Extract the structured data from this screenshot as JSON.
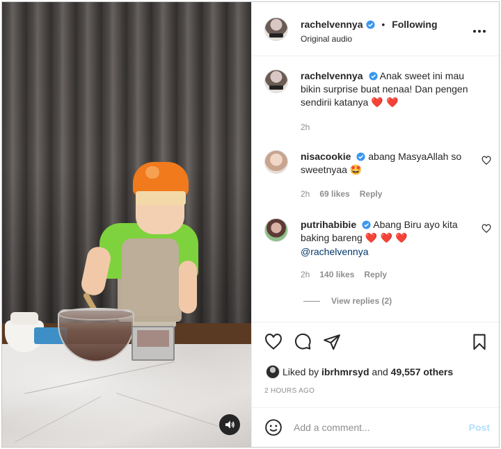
{
  "post": {
    "author": "rachelvennya",
    "follow_status": "Following",
    "separator": "•",
    "audio": "Original audio"
  },
  "caption": {
    "username": "rachelvennya",
    "text": "Anak sweet ini mau bikin surprise buat nenaa! Dan pengen sendirii katanya",
    "emoji": "❤️ ❤️",
    "time": "2h"
  },
  "comments": [
    {
      "username": "nisacookie",
      "text": "abang MasyaAllah so sweetnyaa",
      "emoji": "🤩",
      "time": "2h",
      "likes": "69 likes",
      "reply": "Reply"
    },
    {
      "username": "putrihabibie",
      "text": "Abang Biru ayo kita baking bareng",
      "emoji": "❤️ ❤️ ❤️",
      "mention": "@rachelvennya",
      "time": "2h",
      "likes": "140 likes",
      "reply": "Reply",
      "view_replies": "View replies (2)"
    }
  ],
  "likes": {
    "prefix": "Liked by",
    "user": "ibrhmrsyd",
    "conjunction": "and",
    "count": "49,557 others"
  },
  "timestamp": "2 HOURS AGO",
  "add_comment": {
    "placeholder": "Add a comment...",
    "post_label": "Post"
  },
  "icons": {
    "verified": "verified-badge-icon",
    "more": "more-options-icon",
    "like": "heart-icon",
    "comment": "comment-icon",
    "share": "share-icon",
    "save": "bookmark-icon",
    "emoji": "emoji-icon",
    "sound": "sound-on-icon"
  },
  "colors": {
    "verified": "#3897f0",
    "link": "#00376b",
    "post_disabled": "#b2dffc",
    "meta": "#8e8e8e"
  }
}
